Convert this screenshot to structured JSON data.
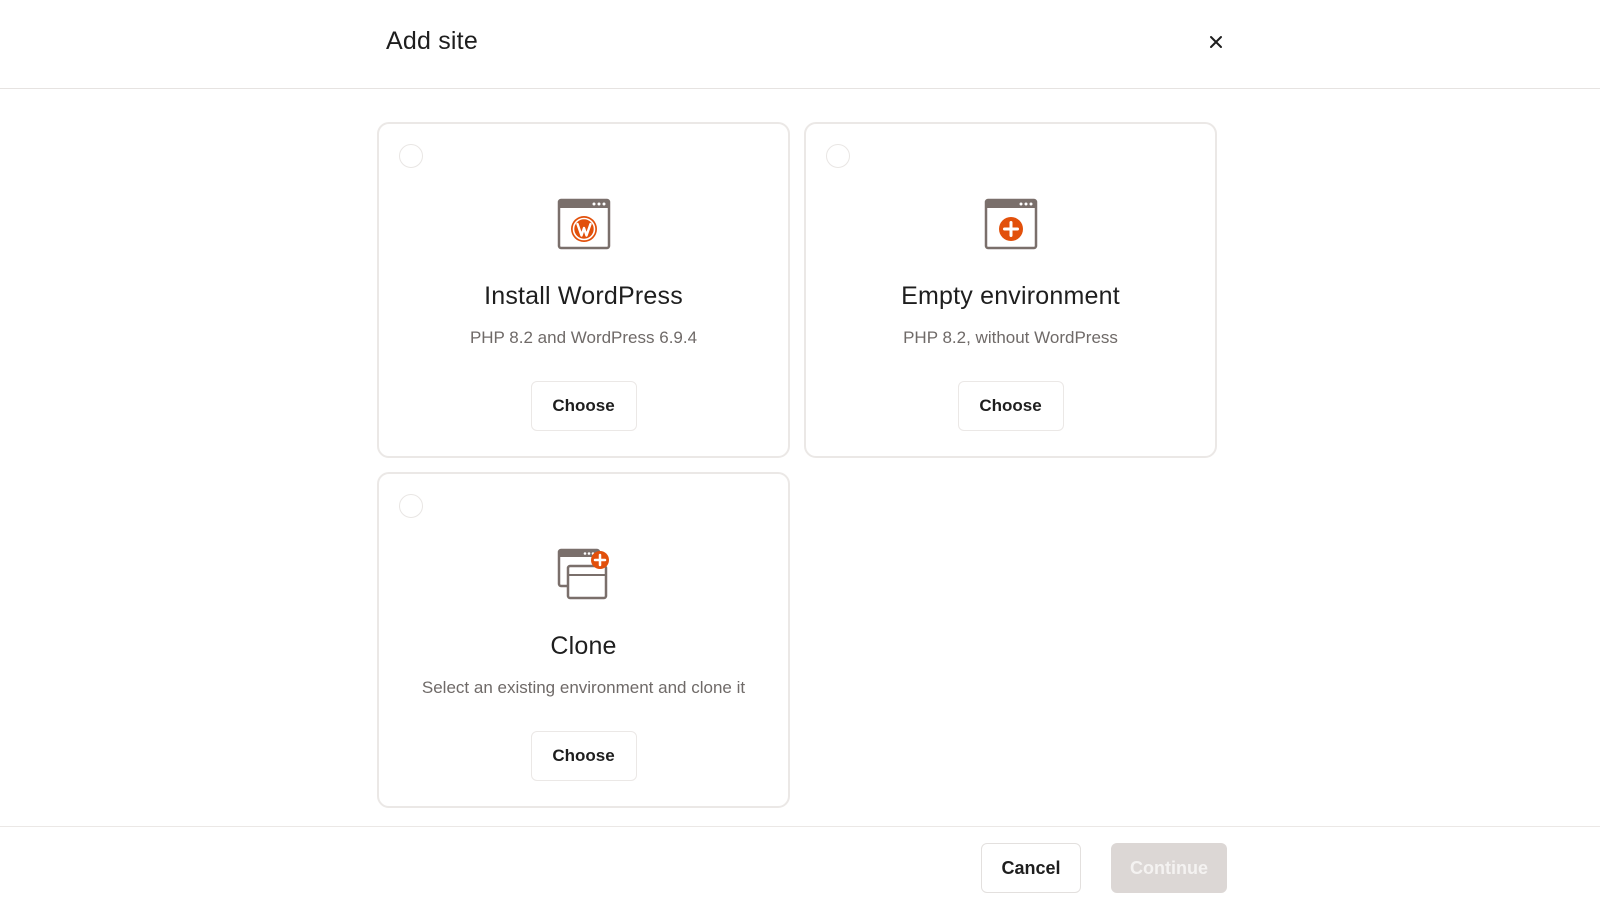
{
  "dialog": {
    "title": "Add site",
    "close_icon": "close-icon"
  },
  "options": [
    {
      "icon": "wordpress-window-icon",
      "title": "Install WordPress",
      "description": "PHP 8.2 and WordPress 6.9.4",
      "button_label": "Choose",
      "selected": false
    },
    {
      "icon": "add-window-icon",
      "title": "Empty environment",
      "description": "PHP 8.2, without WordPress",
      "button_label": "Choose",
      "selected": false
    },
    {
      "icon": "clone-window-icon",
      "title": "Clone",
      "description": "Select an existing environment and clone it",
      "button_label": "Choose",
      "selected": false
    }
  ],
  "footer": {
    "cancel_label": "Cancel",
    "continue_label": "Continue",
    "continue_enabled": false
  },
  "colors": {
    "accent": "#e2500b",
    "icon_frame": "#7a6f6b",
    "border": "#ebe8e6",
    "disabled_button": "#dcd7d5"
  }
}
